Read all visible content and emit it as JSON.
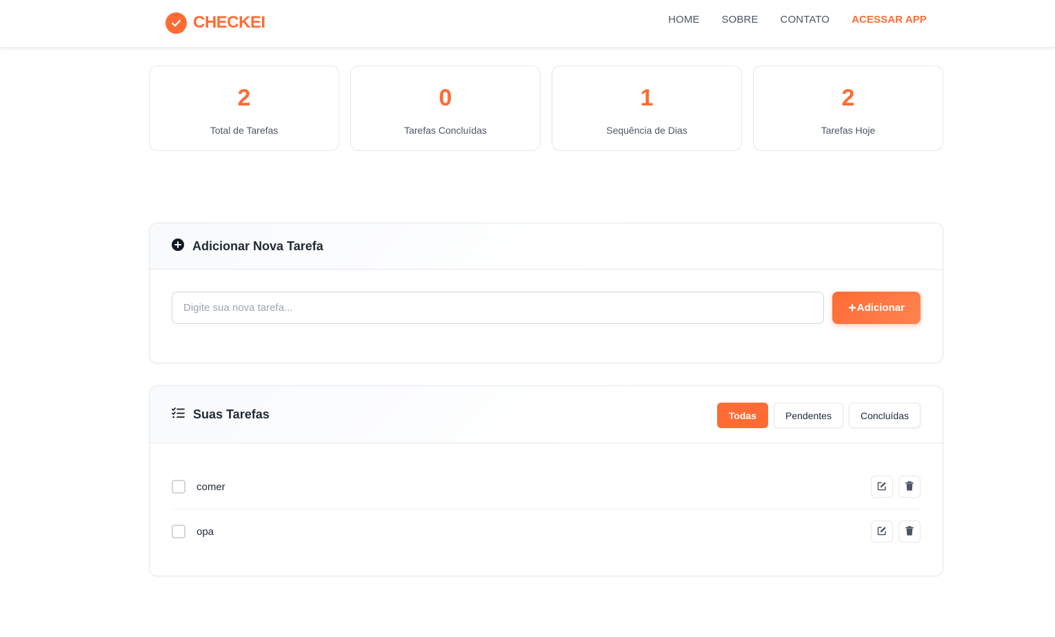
{
  "header": {
    "logo_text": "CHECKEI",
    "nav": [
      {
        "label": "HOME"
      },
      {
        "label": "SOBRE"
      },
      {
        "label": "CONTATO"
      },
      {
        "label": "ACESSAR APP"
      }
    ]
  },
  "stats": [
    {
      "value": "2",
      "label": "Total de Tarefas"
    },
    {
      "value": "0",
      "label": "Tarefas Concluídas"
    },
    {
      "value": "1",
      "label": "Sequência de Dias"
    },
    {
      "value": "2",
      "label": "Tarefas Hoje"
    }
  ],
  "add_task": {
    "title": "Adicionar Nova Tarefa",
    "input_placeholder": "Digite sua nova tarefa...",
    "input_value": "",
    "button_label": "Adicionar",
    "button_icon": "plus-icon"
  },
  "tasks": {
    "title": "Suas Tarefas",
    "filters": [
      {
        "label": "Todas",
        "active": true
      },
      {
        "label": "Pendentes",
        "active": false
      },
      {
        "label": "Concluídas",
        "active": false
      }
    ],
    "items": [
      {
        "text": "comer",
        "done": false
      },
      {
        "text": "opa",
        "done": false
      }
    ]
  },
  "colors": {
    "accent": "#ff6b35",
    "text": "#1f2937",
    "muted": "#4b5563",
    "border": "#e5e7eb"
  }
}
